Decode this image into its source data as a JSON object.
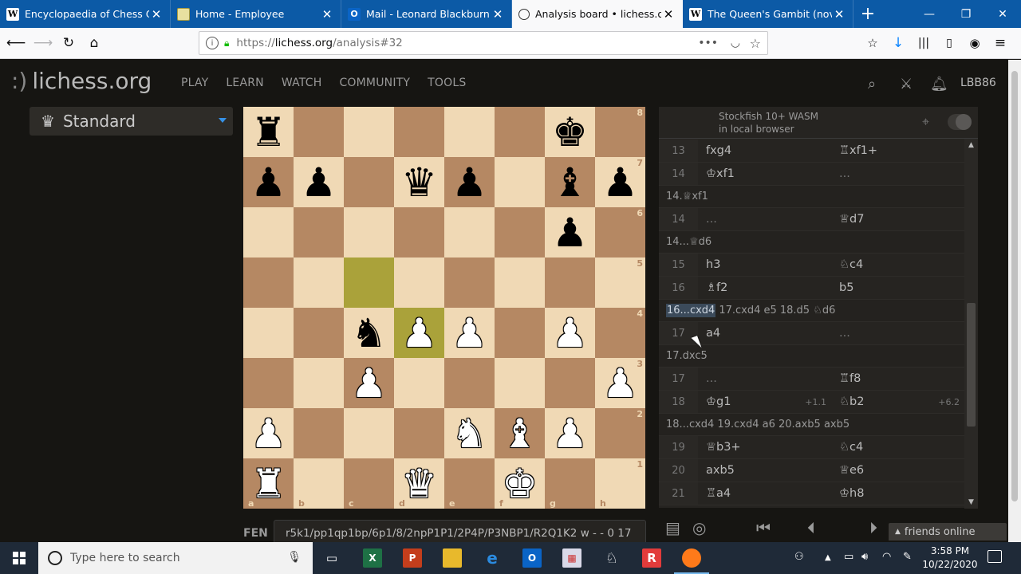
{
  "browser": {
    "tabs": [
      {
        "title": "Encyclopaedia of Chess Openi",
        "favicon": "W",
        "active": false
      },
      {
        "title": "Home - Employee",
        "favicon": "",
        "active": false
      },
      {
        "title": "Mail - Leonard Blackburn - O",
        "favicon": "O",
        "active": false
      },
      {
        "title": "Analysis board • lichess.org",
        "favicon": "",
        "active": true
      },
      {
        "title": "The Queen's Gambit (novel)",
        "favicon": "W",
        "active": false
      }
    ],
    "url": {
      "protocol": "https://",
      "host": "lichess.org",
      "path": "/analysis#32"
    }
  },
  "site": {
    "logo": "lichess.org",
    "logo_mark": ":)",
    "nav": [
      "PLAY",
      "LEARN",
      "WATCH",
      "COMMUNITY",
      "TOOLS"
    ],
    "username": "LBB86",
    "variant": "Standard"
  },
  "board": {
    "ranks": [
      "r.....k.",
      "pp.qp.bp",
      "......p.",
      "........",
      "..nPP.P.",
      "..P....P",
      "P...NBP.",
      "R..Q.K.."
    ],
    "highlights": [
      "c5",
      "d4"
    ],
    "files": [
      "a",
      "b",
      "c",
      "d",
      "e",
      "f",
      "g",
      "h"
    ],
    "rank_labels": [
      "8",
      "7",
      "6",
      "5",
      "4",
      "3",
      "2",
      "1"
    ]
  },
  "engine": {
    "name_line1": "Stockfish 10+ WASM",
    "name_line2": "in local browser"
  },
  "moves": [
    {
      "type": "row",
      "num": "13",
      "white": "fxg4",
      "black": "♖xf1+"
    },
    {
      "type": "row",
      "num": "14",
      "white": "♔xf1",
      "black": "..."
    },
    {
      "type": "var",
      "current": "",
      "text": "14.♕xf1"
    },
    {
      "type": "row",
      "num": "14",
      "white": "...",
      "black": "♕d7"
    },
    {
      "type": "var",
      "current": "",
      "text": "14...♕d6"
    },
    {
      "type": "row",
      "num": "15",
      "white": "h3",
      "black": "♘c4"
    },
    {
      "type": "row",
      "num": "16",
      "white": "♗f2",
      "black": "b5"
    },
    {
      "type": "var",
      "current": "16...cxd4",
      "text": "17.cxd4 e5 18.d5 ♘d6"
    },
    {
      "type": "row",
      "num": "17",
      "white": "a4",
      "black": "..."
    },
    {
      "type": "var",
      "current": "",
      "text": "17.dxc5"
    },
    {
      "type": "row",
      "num": "17",
      "white": "...",
      "black": "♖f8"
    },
    {
      "type": "row",
      "num": "18",
      "white": "♔g1",
      "white_eval": "+1.1",
      "black": "♘b2",
      "black_eval": "+6.2"
    },
    {
      "type": "var",
      "current": "",
      "text": "18...cxd4 19.cxd4 a6 20.axb5 axb5"
    },
    {
      "type": "row",
      "num": "19",
      "white": "♕b3+",
      "black": "♘c4"
    },
    {
      "type": "row",
      "num": "20",
      "white": "axb5",
      "black": "♕e6"
    },
    {
      "type": "row",
      "num": "21",
      "white": "♖a4",
      "black": "♔h8"
    }
  ],
  "fen": {
    "label": "FEN",
    "value": "r5k1/pp1qp1bp/6p1/8/2npP1P1/2P4P/P3NBP1/R2Q1K2 w - - 0 17"
  },
  "friends": "friends online",
  "taskbar": {
    "search_placeholder": "Type here to search",
    "time": "3:58 PM",
    "date": "10/22/2020"
  },
  "colors": {
    "board_light": "#f0d9b5",
    "board_dark": "#b58863",
    "highlight": "#cdd26a",
    "tabbar": "#0c5aa6"
  }
}
